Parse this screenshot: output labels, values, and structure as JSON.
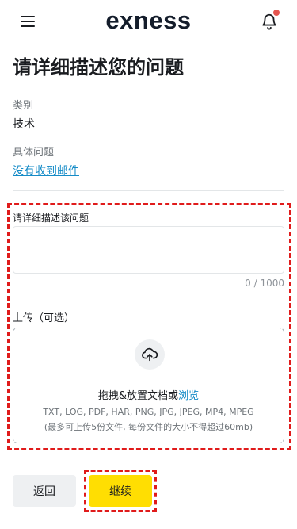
{
  "header": {
    "logo_text": "exness",
    "menu_icon": "hamburger-menu-icon",
    "bell_icon": "notification-bell-icon",
    "notification_dot_color": "#e5554f"
  },
  "page": {
    "title": "请详细描述您的问题"
  },
  "summary": {
    "category_label": "类别",
    "category_value": "技术",
    "issue_label": "具体问题",
    "issue_value": "没有收到邮件"
  },
  "form": {
    "description_label": "请详细描述该问题",
    "description_value": "",
    "description_counter": "0 / 1000",
    "upload_label": "上传（可选）",
    "upload_icon": "cloud-upload-icon",
    "drop_text": "拖拽&放置文档或",
    "browse_link": "浏览",
    "file_types": "TXT, LOG, PDF, HAR, PNG, JPG, JPEG, MP4, MPEG",
    "file_limit": "(最多可上传5份文件, 每份文件的大小不得超过60mb)"
  },
  "actions": {
    "back_label": "返回",
    "continue_label": "继续"
  },
  "colors": {
    "accent_yellow": "#ffde02",
    "link_blue": "#158bc7",
    "highlight_red": "#e01b1b"
  }
}
